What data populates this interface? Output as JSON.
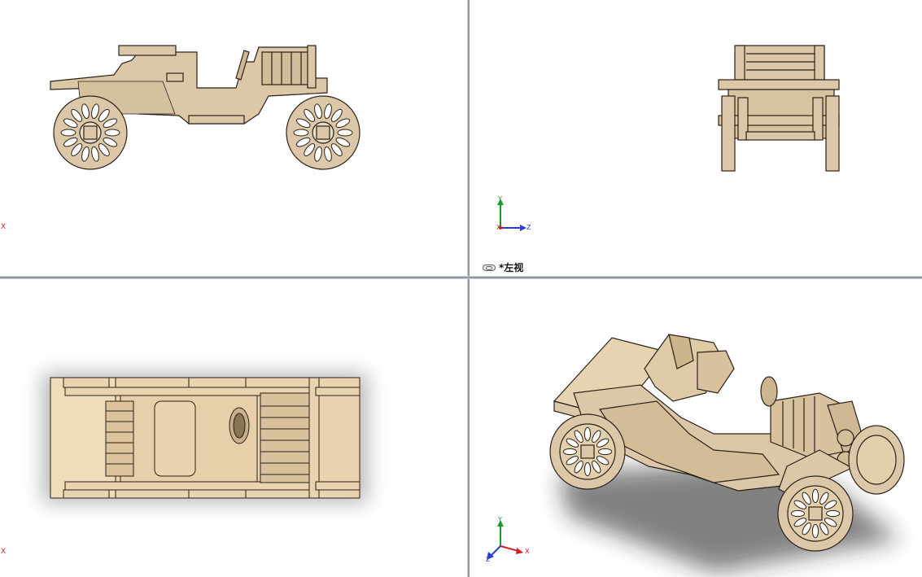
{
  "viewports": {
    "top_left": {
      "axis_label": "X"
    },
    "top_right": {
      "view_name": "*左视",
      "triad": {
        "y": "Y",
        "z": "Z",
        "x": "X"
      }
    },
    "bottom_left": {
      "axis_label": "X"
    },
    "bottom_right": {
      "triad": {
        "y": "Y",
        "z": "Z",
        "x": "X"
      }
    }
  },
  "colors": {
    "wood": "#dcc8a8",
    "wood_dark": "#b9a07a",
    "outline": "#2b2118",
    "axis_x": "#d21e1e",
    "axis_y": "#1d9a2a",
    "axis_z": "#2a3ed6",
    "divider": "#8f98a4"
  }
}
